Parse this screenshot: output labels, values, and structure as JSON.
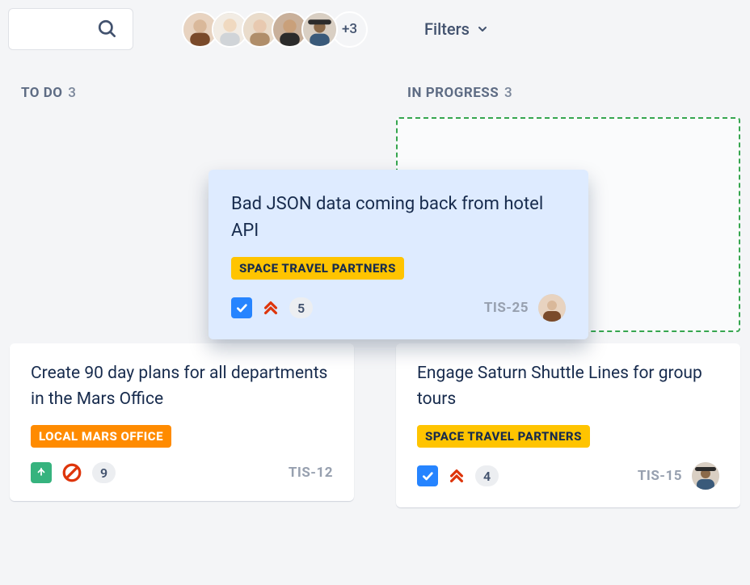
{
  "topbar": {
    "avatar_overflow": "+3",
    "filters_label": "Filters"
  },
  "columns": [
    {
      "title": "TO DO",
      "count": "3"
    },
    {
      "title": "IN PROGRESS",
      "count": "3"
    }
  ],
  "dragged_card": {
    "title": "Bad JSON data coming back from hotel API",
    "label": "SPACE TRAVEL PARTNERS",
    "points": "5",
    "key": "TIS-25"
  },
  "card_todo": {
    "title": "Create 90 day plans for all departments in the Mars Office",
    "label": "LOCAL MARS OFFICE",
    "points": "9",
    "key": "TIS-12"
  },
  "card_inprogress": {
    "title": "Engage Saturn Shuttle Lines for group tours",
    "label": "SPACE TRAVEL PARTNERS",
    "points": "4",
    "key": "TIS-15"
  },
  "avatars": {
    "a1": {
      "bg": "#d9b89a",
      "shirt": "#7a4a2a"
    },
    "a2": {
      "bg": "#f0d9c0",
      "shirt": "#d0d4d8"
    },
    "a3": {
      "bg": "#e8c9b0",
      "shirt": "#b08e6a"
    },
    "a4": {
      "bg": "#c9a07a",
      "shirt": "#2b2b2b"
    },
    "a5": {
      "bg": "#8b6a4a",
      "shirt": "#3a5a7a"
    },
    "assignee1": {
      "bg": "#d9b89a",
      "shirt": "#7a4a2a"
    },
    "assignee2": {
      "bg": "#8b6a4a",
      "shirt": "#3a5a7a"
    }
  }
}
